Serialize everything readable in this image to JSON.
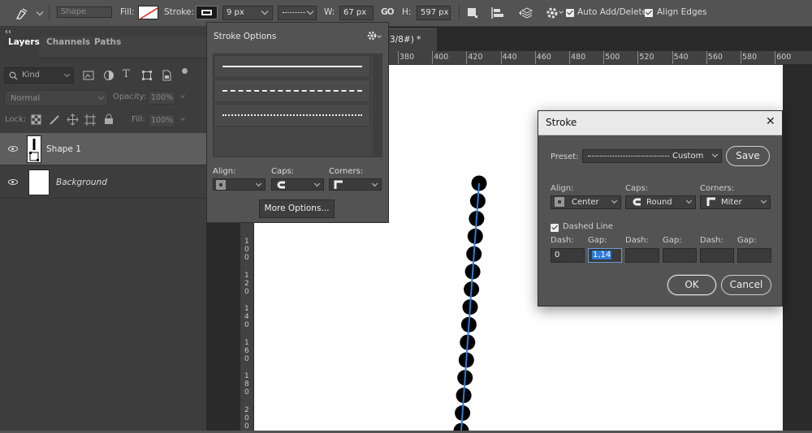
{
  "options_bar": {
    "tool_mode": "Shape",
    "fill_label": "Fill:",
    "stroke_label": "Stroke:",
    "stroke_width": "9 px",
    "width_label": "W:",
    "width_value": "67 px",
    "height_label": "H:",
    "height_value": "597 px",
    "link_glyph": "GO",
    "auto_add_delete_label": "Auto Add/Delete",
    "align_edges_label": "Align Edges",
    "collapse_glyph": "‹‹"
  },
  "layers_panel": {
    "tabs": [
      "Layers",
      "Channels",
      "Paths"
    ],
    "kind_placeholder": "Kind",
    "blend_mode": "Normal",
    "opacity_label": "Opacity:",
    "opacity_value": "100%",
    "lock_label": "Lock:",
    "fill_label": "Fill:",
    "fill_value": "100%",
    "layers": [
      {
        "name": "Shape 1",
        "selected": true
      },
      {
        "name": "Background",
        "selected": false
      }
    ]
  },
  "document": {
    "tab_title_fragment": "3/8#) *",
    "ruler_top": [
      "380",
      "400",
      "420",
      "440",
      "460",
      "480",
      "500",
      "520",
      "540",
      "560",
      "580",
      "600"
    ],
    "ruler_left": [
      "1\n0\n0",
      "1\n2\n0",
      "1\n4\n0",
      "1\n6\n0",
      "1\n8\n0",
      "2\n0\n0"
    ]
  },
  "stroke_options_popup": {
    "title": "Stroke Options",
    "align_label": "Align:",
    "caps_label": "Caps:",
    "corners_label": "Corners:",
    "more_options_label": "More Options..."
  },
  "stroke_dialog": {
    "title": "Stroke",
    "preset_label": "Preset:",
    "preset_value": "Custom",
    "save_label": "Save",
    "align_label": "Align:",
    "align_value": "Center",
    "caps_label": "Caps:",
    "caps_value": "Round",
    "corners_label": "Corners:",
    "corners_value": "Miter",
    "dashed_line_label": "Dashed Line",
    "dash_headers": [
      "Dash:",
      "Gap:",
      "Dash:",
      "Gap:",
      "Dash:",
      "Gap:"
    ],
    "dash_values": [
      "0",
      "1,14",
      "",
      "",
      "",
      ""
    ],
    "ok_label": "OK",
    "cancel_label": "Cancel",
    "close_glyph": "✕"
  },
  "colors": {
    "accent": "#2d7bd6",
    "panel_bg": "#535353",
    "dark_bg": "#3d3d3d",
    "canvas": "#ffffff"
  }
}
